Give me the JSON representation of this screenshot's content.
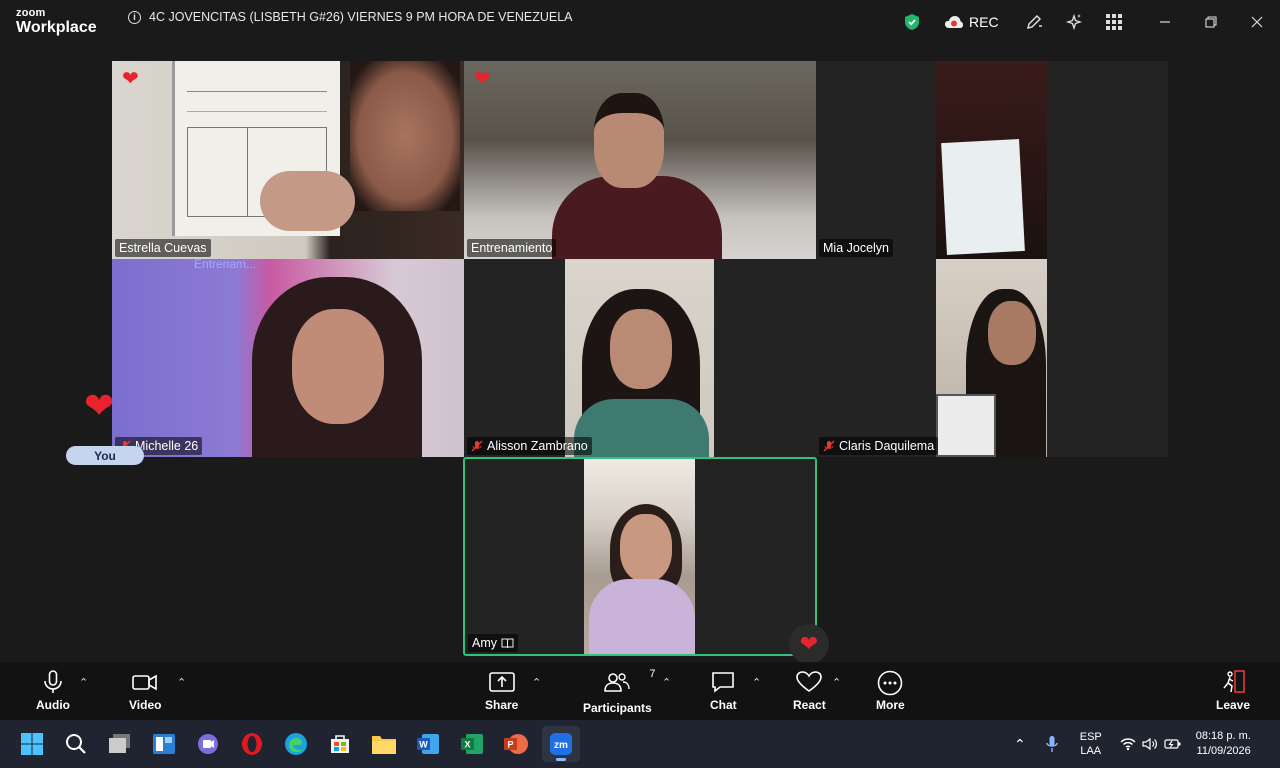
{
  "app": {
    "logo_top": "zoom",
    "logo_bottom": "Workplace",
    "meeting_title": "4C JOVENCITAS (LISBETH G#26) VIERNES 9 PM HORA DE VENEZUELA",
    "rec_label": "REC"
  },
  "participants": [
    {
      "name": "Estrella Cuevas"
    },
    {
      "name": "Entrenamiento"
    },
    {
      "name": "Mia Jocelyn"
    },
    {
      "name": "Michelle 26"
    },
    {
      "name": "Alisson Zambrano"
    },
    {
      "name": "Claris Daquilema"
    },
    {
      "name": "Amy"
    }
  ],
  "you_label": "You",
  "entrenam_overlay": "Entrenam...",
  "toolbar": {
    "audio": "Audio",
    "video": "Video",
    "share": "Share",
    "participants": "Participants",
    "participants_count": "7",
    "chat": "Chat",
    "react": "React",
    "more": "More",
    "leave": "Leave"
  },
  "taskbar": {
    "lang_top": "ESP",
    "lang_bottom": "LAA",
    "time": "08:18 p. m.",
    "date": "11/09/2026"
  },
  "colors": {
    "active_speaker": "#2ec27e",
    "heart": "#e8232d",
    "leave": "#e0383e"
  }
}
